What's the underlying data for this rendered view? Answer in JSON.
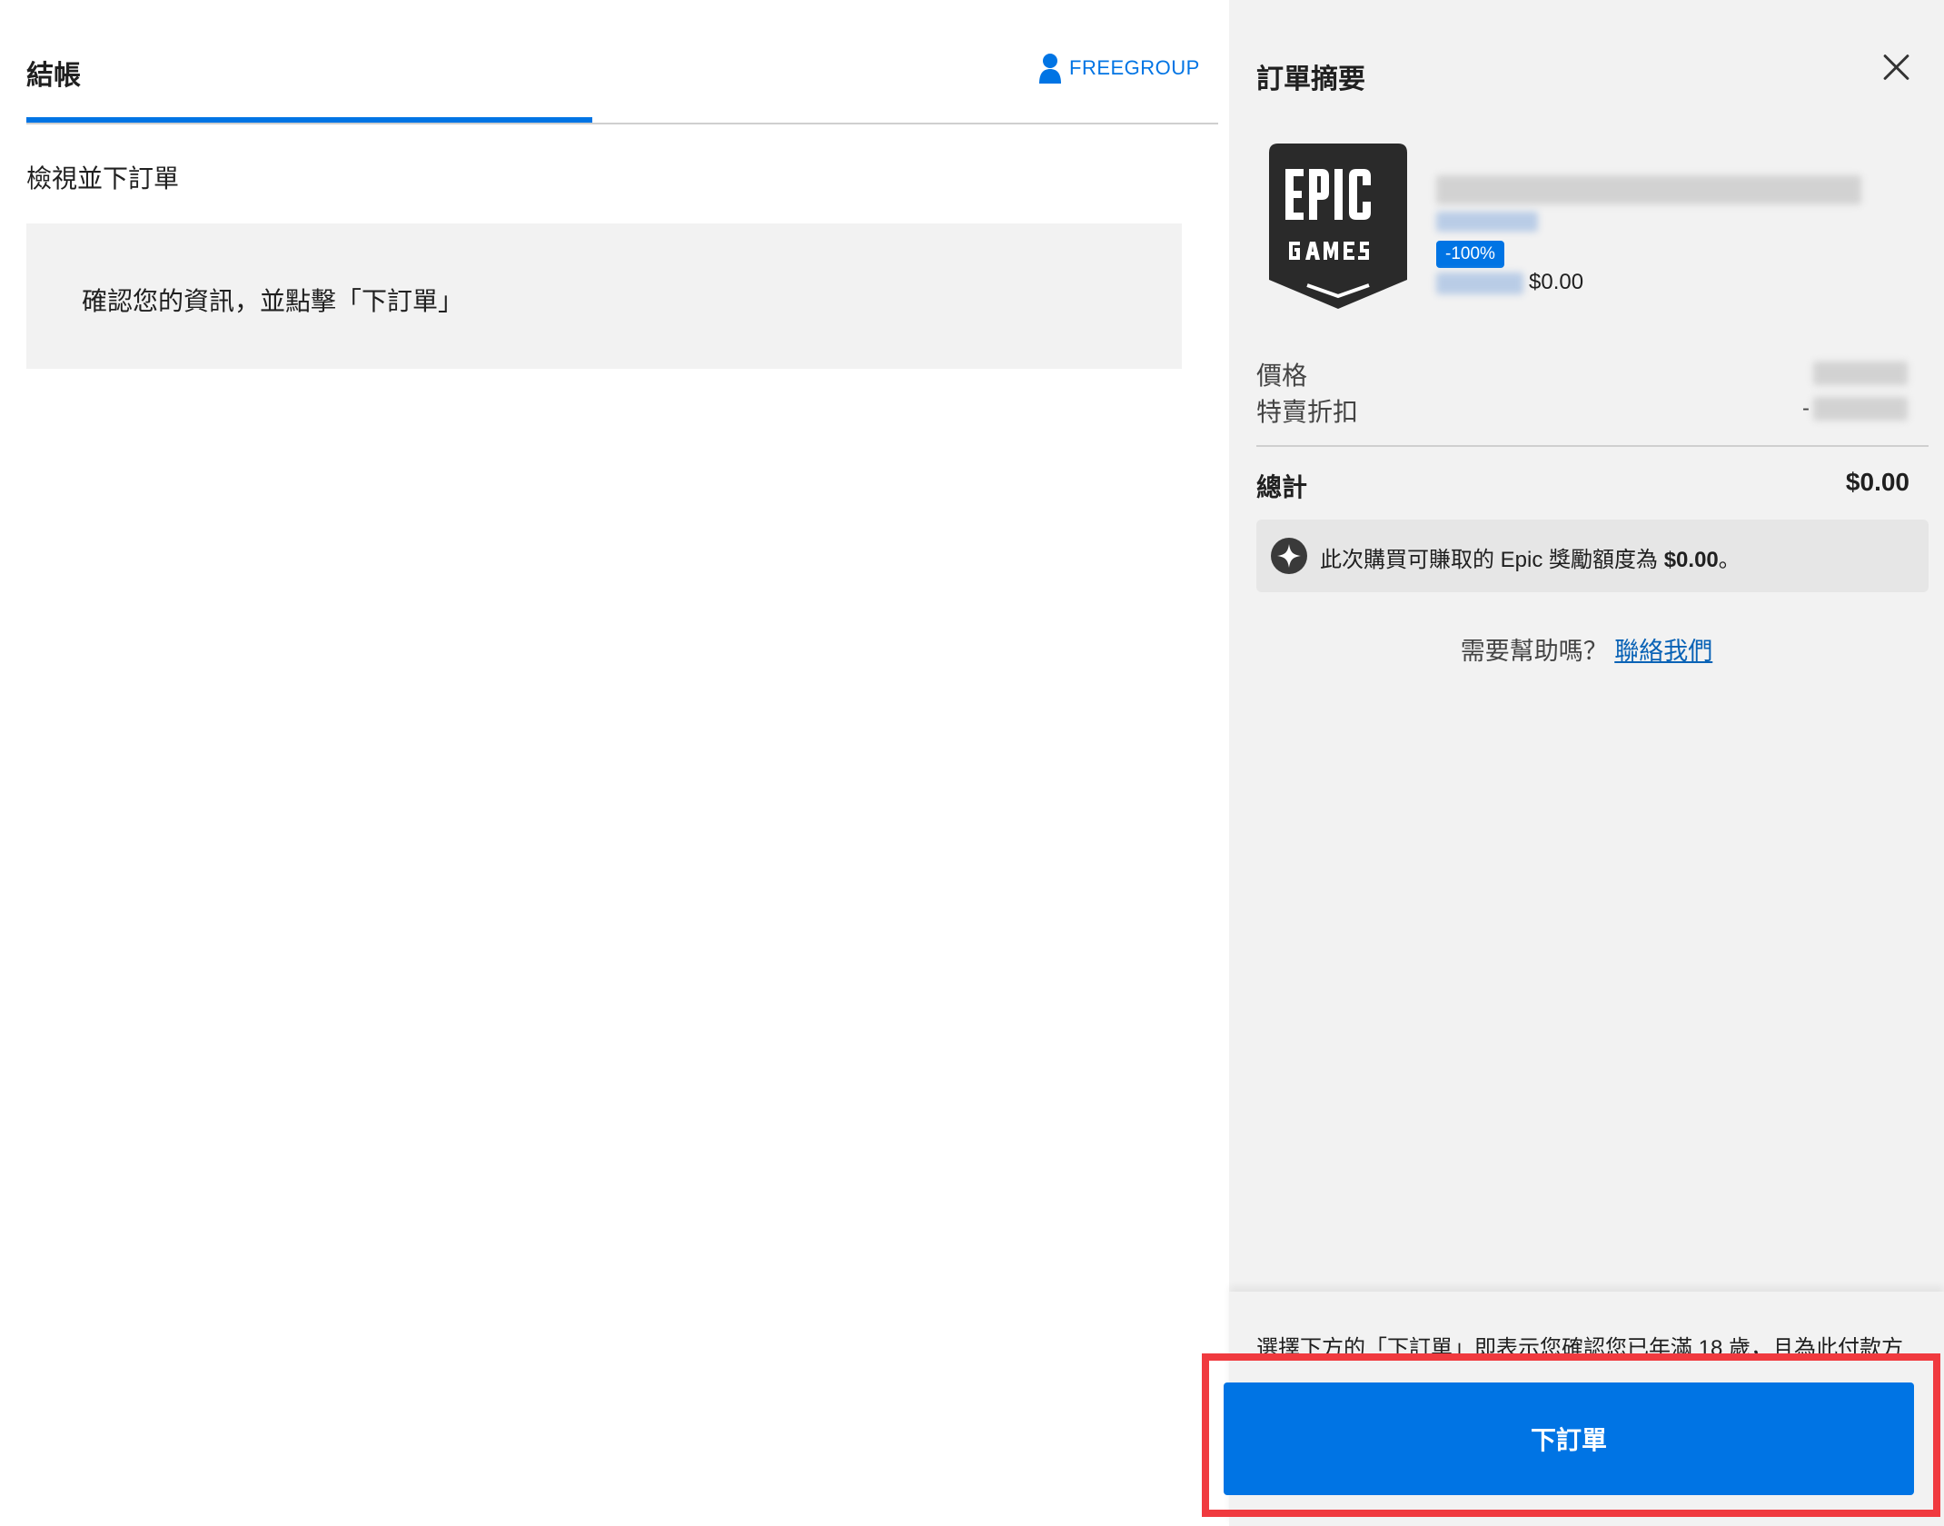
{
  "header": {
    "title": "結帳",
    "username": "FREEGROUP"
  },
  "main": {
    "step_title": "檢視並下訂單",
    "notice": "確認您的資訊，並點擊「下訂單」"
  },
  "summary": {
    "title": "訂單摘要",
    "item": {
      "discount_badge": "-100%",
      "price": "$0.00"
    },
    "rows": {
      "price_label": "價格",
      "discount_label": "特賣折扣",
      "discount_prefix": "-",
      "total_label": "總計",
      "total_value": "$0.00"
    },
    "reward": {
      "text": "此次購買可賺取的 Epic 獎勵額度為",
      "amount": "$0.00",
      "suffix": "。"
    },
    "help": {
      "question": "需要幫助嗎？",
      "link": "聯絡我們"
    },
    "footer": {
      "legal": "選擇下方的「下訂單」即表示您確認您已年滿 18 歲，且為此付款方",
      "place_order": "下訂單"
    }
  },
  "colors": {
    "accent": "#0074e4",
    "highlight": "#f03a3f",
    "panel_bg": "#f2f2f2"
  }
}
